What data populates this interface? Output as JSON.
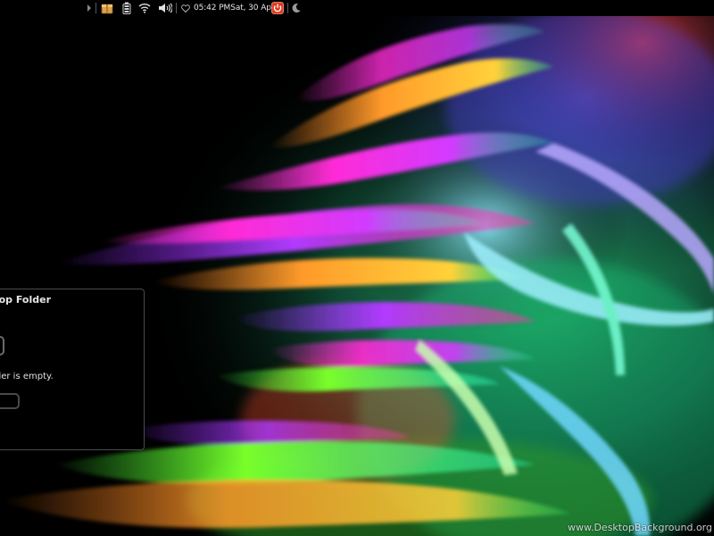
{
  "panel": {
    "clock_time": "05:42 PM",
    "clock_date": "Sat, 30 Apr",
    "tray_icons": [
      "menu-arrow-icon",
      "package-updates-icon",
      "battery-icon",
      "wifi-icon",
      "volume-icon",
      "notification-icon",
      "power-icon",
      "moon-icon"
    ],
    "colors": {
      "panel_bg": "#000000",
      "power_button": "#e03a1e",
      "updates_icon": "#d8a24a"
    }
  },
  "folder_widget": {
    "title": "ktop Folder",
    "empty_text": "older is empty."
  },
  "watermark": {
    "text": "www.DesktopBackground.org"
  }
}
